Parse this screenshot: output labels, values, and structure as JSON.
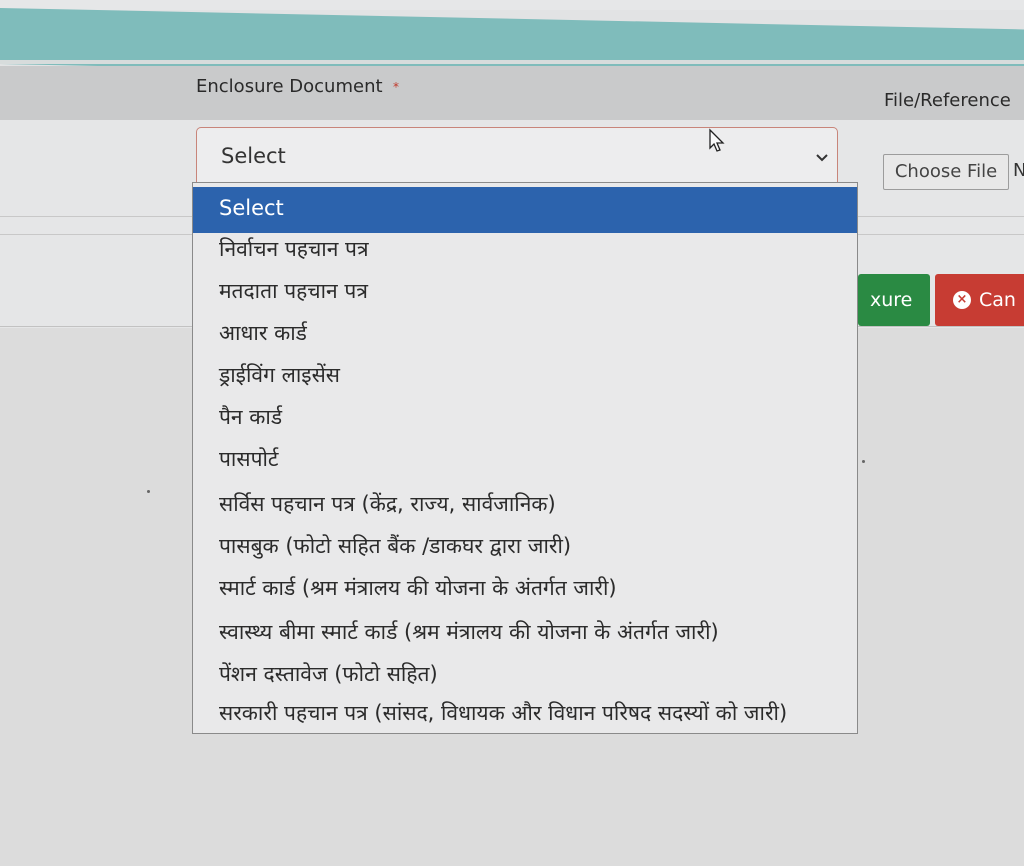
{
  "form": {
    "enclosure_label": "Enclosure Document",
    "required_marker": "*",
    "file_reference_label": "File/Reference",
    "select_value": "Select",
    "choose_file_label": "Choose File",
    "no_file_text": "N",
    "annexure_button_label": "xure",
    "cancel_button_label": "Can"
  },
  "dropdown": {
    "options": [
      "Select",
      "निर्वाचन पहचान पत्र",
      "मतदाता पहचान पत्र",
      "आधार कार्ड",
      "ड्राईविंग लाइसेंस",
      "पैन कार्ड",
      "पासपोर्ट",
      "सर्विस पहचान पत्र (केंद्र, राज्य, सार्वजानिक)",
      "पासबुक (फोटो सहित बैंक /डाकघर द्वारा जारी)",
      "स्मार्ट कार्ड (श्रम मंत्रालय की योजना के अंतर्गत जारी)",
      "स्वास्थ्य बीमा स्मार्ट कार्ड (श्रम मंत्रालय की योजना के अंतर्गत जारी)",
      "पेंशन दस्तावेज (फोटो सहित)",
      "सरकारी पहचान पत्र (सांसद, विधायक और विधान परिषद सदस्यों को जारी)"
    ],
    "selected_index": 0
  },
  "colors": {
    "header_teal": "#7fbcbb",
    "selected_option": "#2c63ad",
    "annexure_green": "#2a8a43",
    "cancel_red": "#c73c33"
  },
  "icons": {
    "dropdown_arrow": "chevron-down-icon",
    "pointer": "mouse-cursor-icon",
    "cancel": "close-circle-icon"
  }
}
